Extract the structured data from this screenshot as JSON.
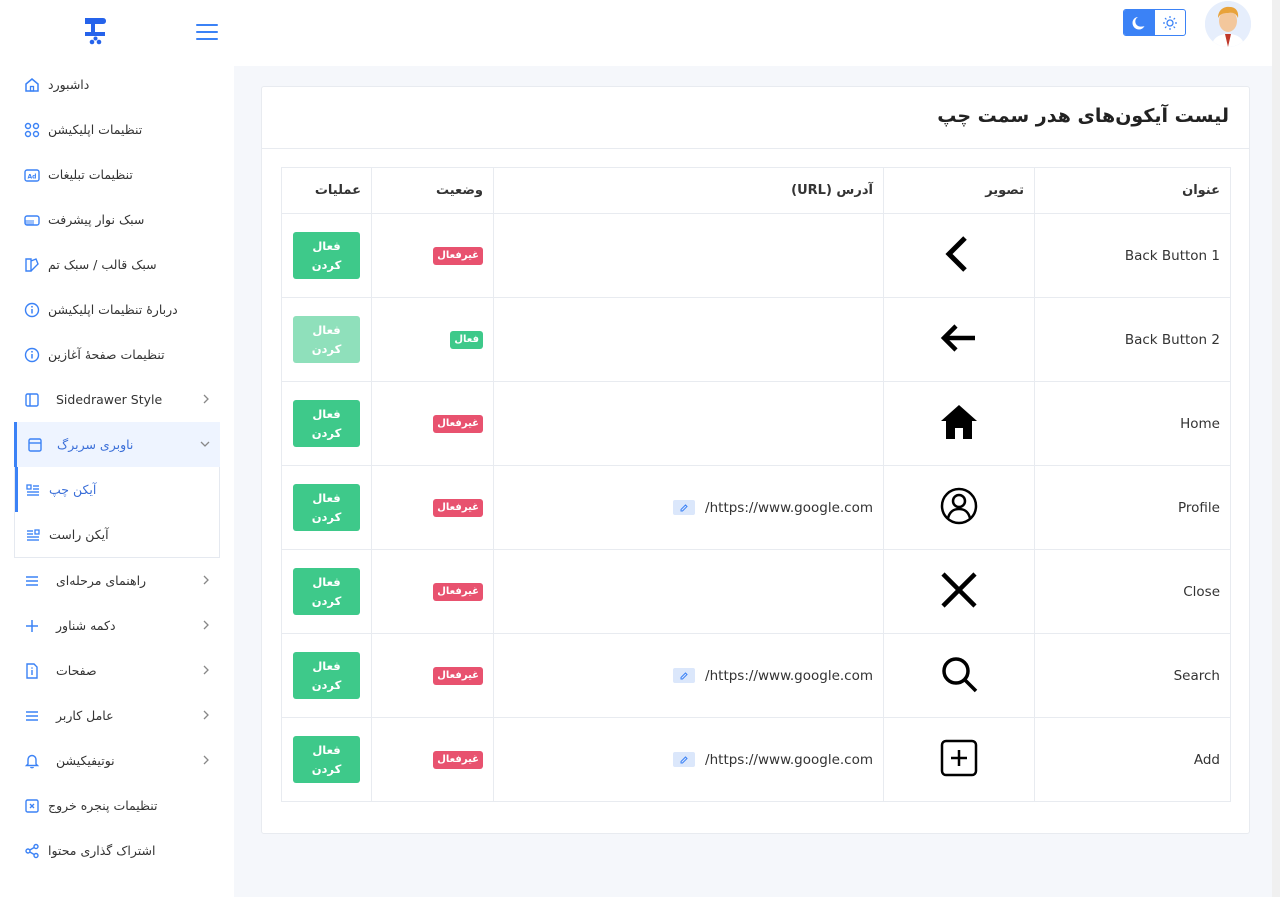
{
  "sidebar": {
    "items": [
      {
        "label": "داشبورد",
        "icon": "home-icon"
      },
      {
        "label": "تنظیمات اپلیکیشن",
        "icon": "apps-icon"
      },
      {
        "label": "تنظیمات تبلیغات",
        "icon": "ad-icon"
      },
      {
        "label": "سبک نوار پیشرفت",
        "icon": "progress-bar-icon"
      },
      {
        "label": "سبک قالب / سبک تم",
        "icon": "theme-icon"
      },
      {
        "label": "دربارهٔ تنظیمات اپلیکیشن",
        "icon": "info-icon"
      },
      {
        "label": "تنظیمات صفحهٔ آغازین",
        "icon": "info-icon"
      },
      {
        "label": "Sidedrawer Style",
        "icon": "sidedrawer-icon"
      },
      {
        "label": "ناوبری سربرگ",
        "icon": "browser-window-icon"
      }
    ],
    "submenu": [
      {
        "label": "آیکن چپ",
        "icon": "align-left-icon"
      },
      {
        "label": "آیکن راست",
        "icon": "align-right-icon"
      }
    ],
    "items_after": [
      {
        "label": "راهنمای مرحله‌ای",
        "icon": "list-icon"
      },
      {
        "label": "دکمه شناور",
        "icon": "plus-icon"
      },
      {
        "label": "صفحات",
        "icon": "page-icon"
      },
      {
        "label": "عامل کاربر",
        "icon": "list-icon"
      },
      {
        "label": "نوتیفیکیشن",
        "icon": "bell-icon"
      },
      {
        "label": "تنظیمات پنجره خروج",
        "icon": "exit-window-icon"
      },
      {
        "label": "اشتراک گذاری محتوا",
        "icon": "share-icon"
      }
    ]
  },
  "card": {
    "title": "لیست آیکون‌های هدر سمت چپ"
  },
  "table": {
    "headers": {
      "title": "عنوان",
      "image": "تصویر",
      "url": "آدرس (URL)",
      "status": "وضعیت",
      "ops": "عملیات"
    },
    "rows": [
      {
        "title": "Back Button 1",
        "icon": "chevron-left-icon",
        "url": "",
        "status": "غیرفعال",
        "status_type": "off",
        "action": "فعال کردن",
        "action_disabled": false
      },
      {
        "title": "Back Button 2",
        "icon": "arrow-left-icon",
        "url": "",
        "status": "فعال",
        "status_type": "on",
        "action": "فعال کردن",
        "action_disabled": true
      },
      {
        "title": "Home",
        "icon": "home-solid-icon",
        "url": "",
        "status": "غیرفعال",
        "status_type": "off",
        "action": "فعال کردن",
        "action_disabled": false
      },
      {
        "title": "Profile",
        "icon": "user-circle-icon",
        "url": "https://www.google.com/",
        "status": "غیرفعال",
        "status_type": "off",
        "action": "فعال کردن",
        "action_disabled": false
      },
      {
        "title": "Close",
        "icon": "close-icon",
        "url": "",
        "status": "غیرفعال",
        "status_type": "off",
        "action": "فعال کردن",
        "action_disabled": false
      },
      {
        "title": "Search",
        "icon": "search-icon",
        "url": "https://www.google.com/",
        "status": "غیرفعال",
        "status_type": "off",
        "action": "فعال کردن",
        "action_disabled": false
      },
      {
        "title": "Add",
        "icon": "add-square-icon",
        "url": "https://www.google.com/",
        "status": "غیرفعال",
        "status_type": "off",
        "action": "فعال کردن",
        "action_disabled": false
      }
    ]
  },
  "colors": {
    "accent": "#3b82f6",
    "success": "#3ec98a",
    "danger": "#e8526f"
  }
}
